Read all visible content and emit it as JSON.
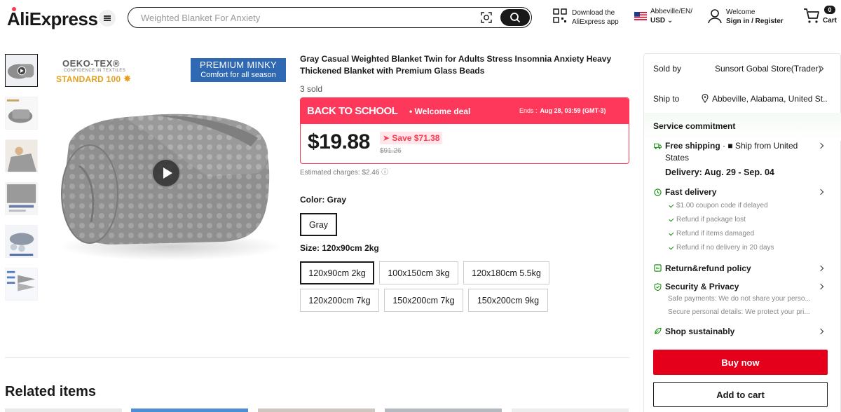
{
  "header": {
    "logo": "AliExpress",
    "search_placeholder": "Weighted Blanket For Anxiety",
    "app_line1": "Download the",
    "app_line2": "AliExpress app",
    "locale_line1": "Abbeville/EN/",
    "locale_line2": "USD",
    "account_line1": "Welcome",
    "account_line2": "Sign in / Register",
    "cart_count": "0",
    "cart_label": "Cart"
  },
  "gallery": {
    "oeko_title": "OEKO-TEX®",
    "oeko_sub": "CONFIDENCE IN TEXTILES",
    "oeko_std": "STANDARD 100",
    "premium_line1": "PREMIUM MINKY",
    "premium_line2": "Comfort for all season"
  },
  "product": {
    "title": "Gray Casual Weighted Blanket Twin for Adults Stress Insomnia Anxiety Heavy Thickened Blanket with Premium Glass Beads",
    "sold": "3 sold",
    "deal_name": "BACK TO SCHOOL",
    "deal_sub": "• Welcome deal",
    "ends_label": "Ends :",
    "ends_value": "Aug 28, 03:59 (GMT-3)",
    "price": "$19.88",
    "save": "Save $71.38",
    "original_price": "$91.26",
    "estimated": "Estimated charges: $2.46 ⓘ",
    "color_label": "Color: Gray",
    "color_options": [
      "Gray"
    ],
    "size_label": "Size: 120x90cm 2kg",
    "size_options": [
      "120x90cm 2kg",
      "100x150cm 3kg",
      "120x180cm 5.5kg",
      "120x200cm 7kg",
      "150x200cm 7kg",
      "150x200cm 9kg"
    ]
  },
  "related_title": "Related items",
  "panel": {
    "sold_by_label": "Sold by",
    "sold_by_value": "Sunsort Gobal Store(Trader)",
    "ship_to_label": "Ship to",
    "ship_to_value": "Abbeville, Alabama, United St...",
    "service_title": "Service commitment",
    "free_shipping": "Free shipping",
    "ship_from": "· ■ Ship from United",
    "ship_from_2": "States",
    "delivery": "Delivery: Aug. 29 - Sep. 04",
    "fast_delivery": "Fast delivery",
    "fast_items": [
      "$1.00 coupon code if delayed",
      "Refund if package lost",
      "Refund if items damaged",
      "Refund if no delivery in 20 days"
    ],
    "return_policy": "Return&refund policy",
    "security": "Security & Privacy",
    "security_items": [
      "Safe payments: We do not share your perso...",
      "Secure personal details: We protect your pri..."
    ],
    "sustain": "Shop sustainably",
    "buy_now": "Buy now",
    "add_to_cart": "Add to cart"
  },
  "colors": {
    "accent_red": "#fd385a",
    "buy_red": "#e4001b",
    "service_green": "#0a8800",
    "premium_blue": "#2f68b3"
  }
}
